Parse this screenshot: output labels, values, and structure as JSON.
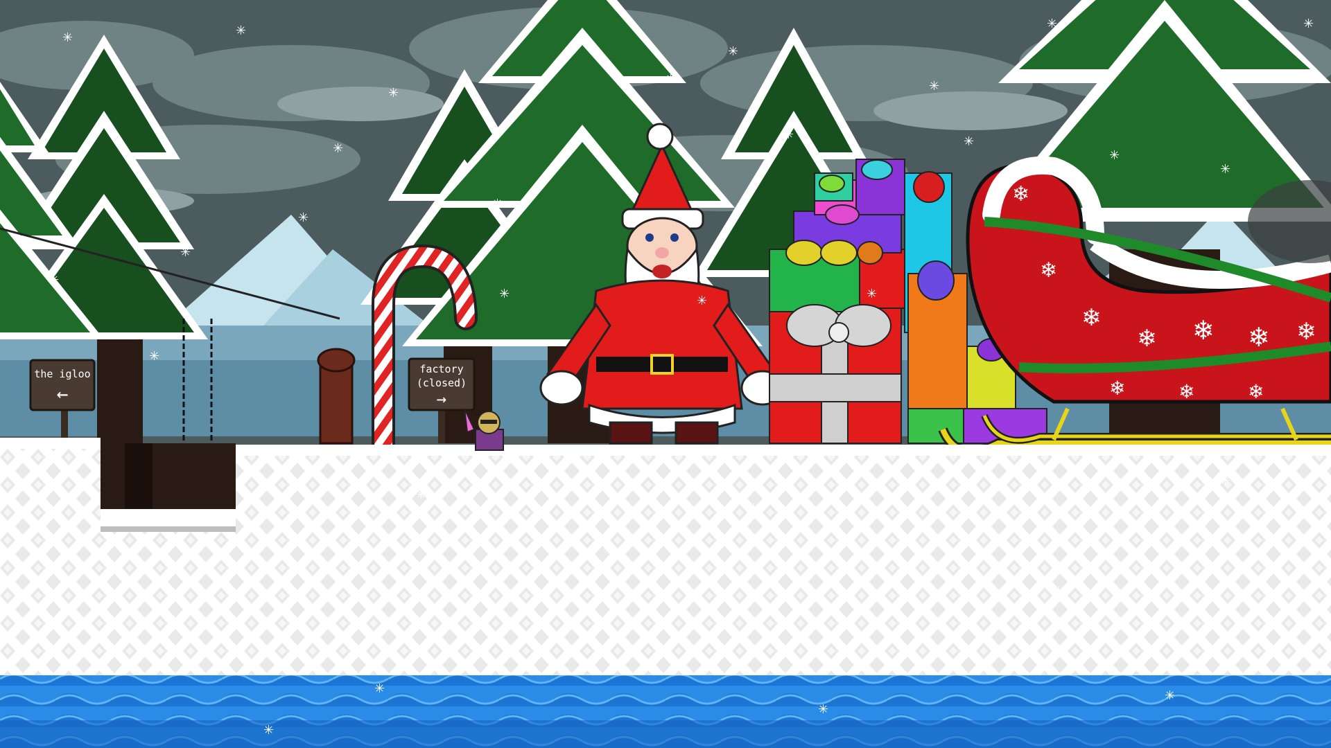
{
  "signs": {
    "igloo": {
      "label": "the igloo",
      "arrow": "←",
      "arrow_icon": "arrow-left-icon"
    },
    "factory": {
      "line1": "factory",
      "line2": "(closed)",
      "arrow": "→",
      "arrow_icon": "arrow-right-icon"
    }
  },
  "colors": {
    "sky": "#4c5b5d",
    "tree_green": "#1f6b2a",
    "snow": "#ffffff",
    "santa_red": "#e21b1b",
    "sleigh_red": "#c8141a",
    "runner_yellow": "#e8d41a",
    "water": "#1e82e0"
  }
}
